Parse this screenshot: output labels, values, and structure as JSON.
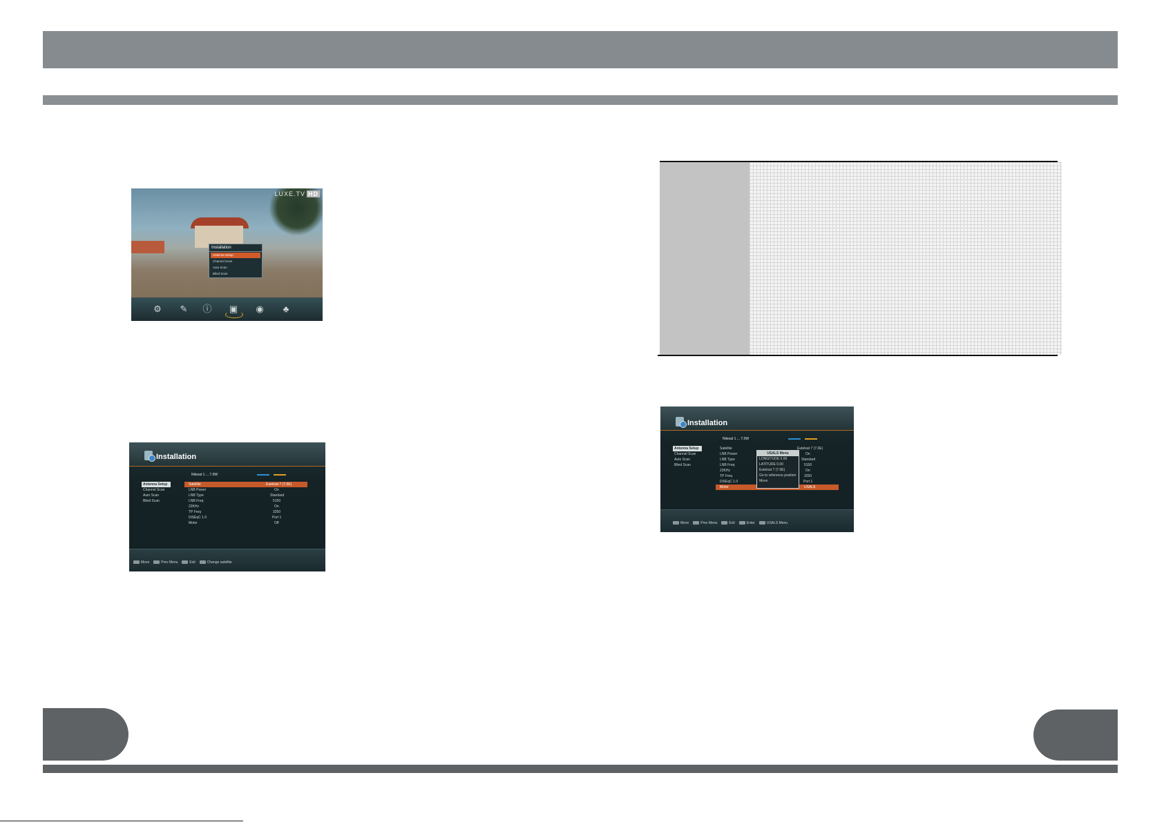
{
  "screen1": {
    "channel_logo": "LUXE.TV",
    "channel_logo_hd": "HD",
    "menu_title": "Installation",
    "menu_items": [
      "Antenna Setup",
      "Channel Scan",
      "Auto Scan",
      "Blind Scan"
    ],
    "dock_icons": [
      "gear-icon",
      "tools-icon",
      "info-icon",
      "installation-icon",
      "camera-icon",
      "gamepad-icon"
    ]
  },
  "screen2": {
    "title": "Installation",
    "transponder": "Nilesat 1 ... 7.0W",
    "side_items": [
      "Antenna Setup",
      "Channel Scan",
      "Auto Scan",
      "Blind Scan"
    ],
    "rows": [
      {
        "label": "Satellite",
        "value": "Eutelsat 7 (7.0E)"
      },
      {
        "label": "LNB Power",
        "value": "On"
      },
      {
        "label": "LNB Type",
        "value": "Standard"
      },
      {
        "label": "LNB Freq",
        "value": "5150"
      },
      {
        "label": "22KHz",
        "value": "On"
      },
      {
        "label": "TP Freq",
        "value": "3250"
      },
      {
        "label": "DiSEqC 1.0",
        "value": "Port 1"
      },
      {
        "label": "Motor",
        "value": "Off"
      }
    ],
    "help": [
      "Move",
      "Prev Menu",
      "Exit",
      "Change satellite"
    ],
    "colors": {
      "selected_row": "#c65a2a",
      "signal_bar": "#2f8fd0",
      "quality_bar": "#e0a020"
    }
  },
  "screen3": {
    "title": "Installation",
    "transponder": "Nilesat 1 ... 7.0W",
    "side_items": [
      "Antenna Setup",
      "Channel Scan",
      "Auto Scan",
      "Blind Scan"
    ],
    "rows": [
      {
        "label": "Satellite",
        "value": "Eutelsat 7 (7.0E)"
      },
      {
        "label": "LNB Power",
        "value": "On"
      },
      {
        "label": "LNB Type",
        "value": "Standard"
      },
      {
        "label": "LNB Freq",
        "value": "5150"
      },
      {
        "label": "22KHz",
        "value": "On"
      },
      {
        "label": "TP Freq",
        "value": "3250"
      },
      {
        "label": "DiSEqC 1.0",
        "value": "Port 1"
      },
      {
        "label": "Motor",
        "value": "USALS"
      }
    ],
    "popup": {
      "title": "USALS Menu",
      "items": [
        "LONGITUDE 0.00",
        "LATITUDE 0.00",
        "Eutelsat 7 (7.0E)",
        "Go to reference position",
        "Move"
      ]
    },
    "help": [
      "Move",
      "Prev Menu",
      "Exit",
      "Enter",
      "USALS Menu"
    ]
  }
}
